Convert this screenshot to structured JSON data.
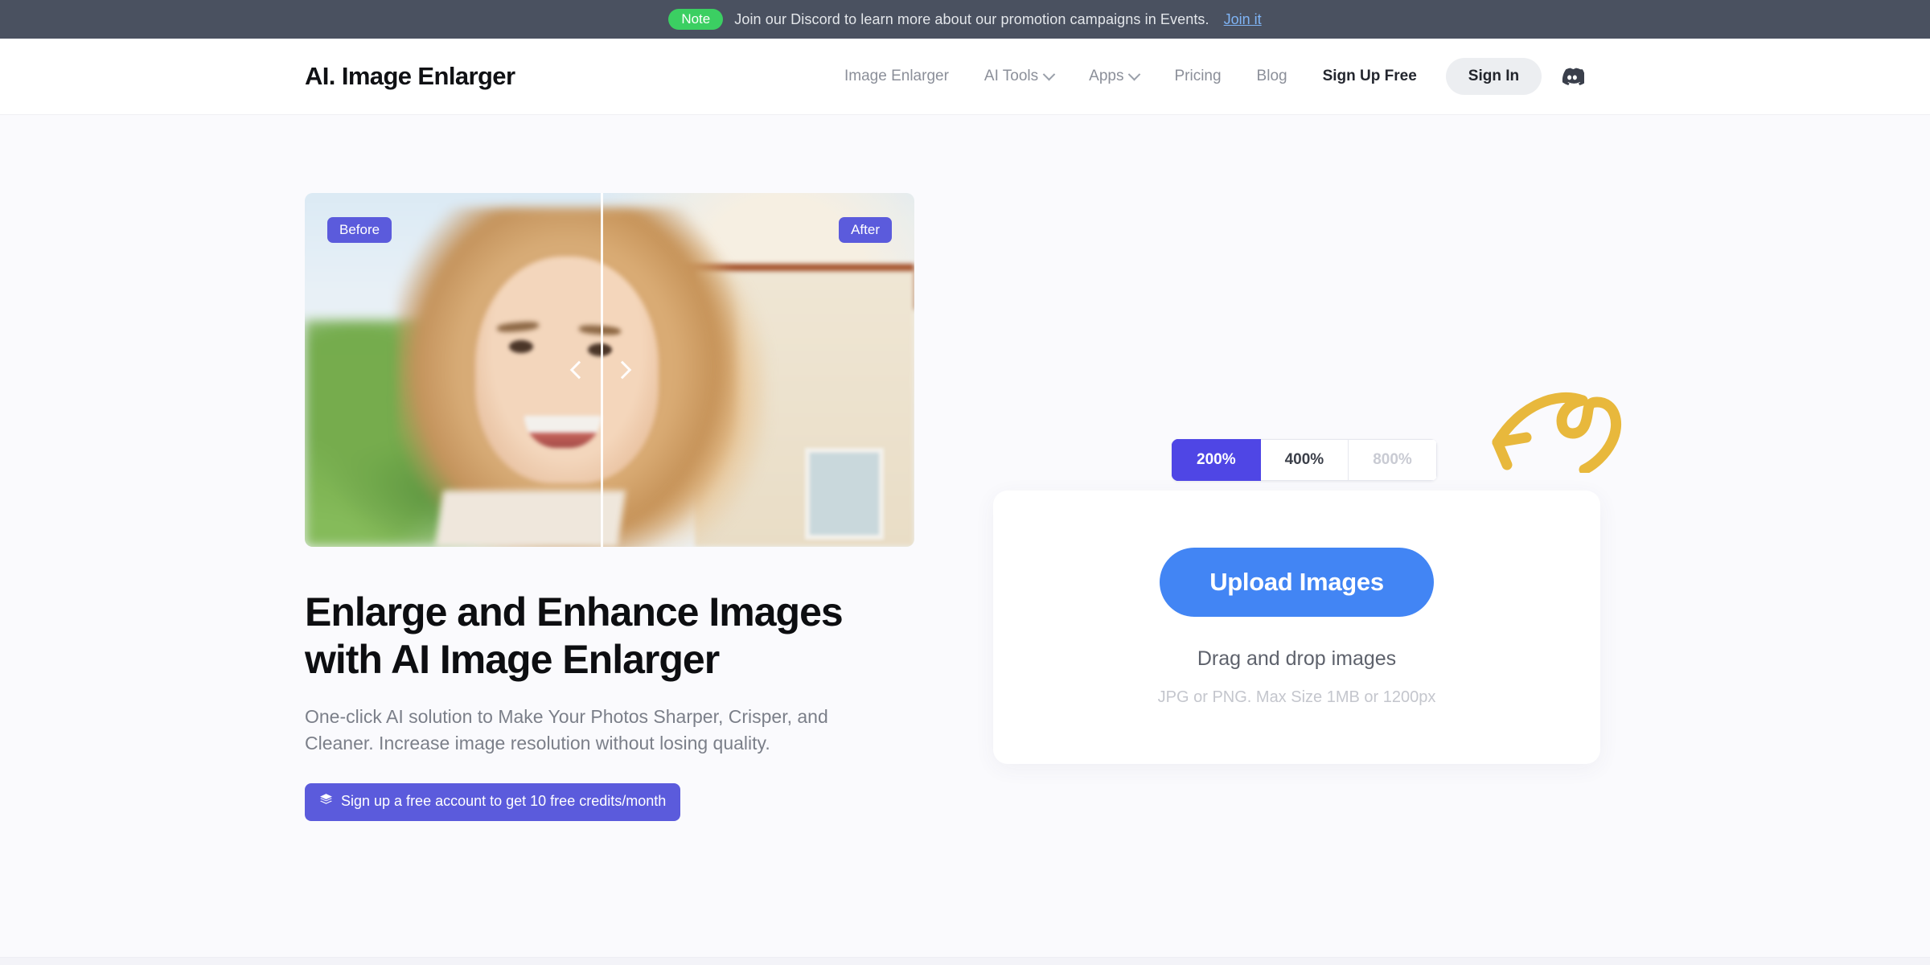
{
  "notice": {
    "badge": "Note",
    "text": "Join our Discord to learn more about our promotion campaigns in Events.",
    "link_label": "Join it",
    "badge_color": "#3bcf62",
    "bar_color": "#4a5160"
  },
  "header": {
    "logo": "AI. Image Enlarger",
    "nav": [
      {
        "label": "Image Enlarger",
        "has_chevron": false
      },
      {
        "label": "AI Tools",
        "has_chevron": true
      },
      {
        "label": "Apps",
        "has_chevron": true
      },
      {
        "label": "Pricing",
        "has_chevron": false
      },
      {
        "label": "Blog",
        "has_chevron": false
      },
      {
        "label": "Sign Up Free",
        "has_chevron": false
      }
    ],
    "sign_in_label": "Sign In",
    "discord_icon": "discord-icon"
  },
  "hero": {
    "compare": {
      "before_badge": "Before",
      "after_badge": "After",
      "prev_icon": "chevron-left-icon",
      "next_icon": "chevron-right-icon",
      "badge_color": "#5b5bdc"
    },
    "headline": "Enlarge and Enhance Images with AI Image Enlarger",
    "subhead": "One-click AI solution to Make Your Photos Sharper, Crisper, and Cleaner. Increase image resolution without losing quality.",
    "credits_cta": {
      "icon": "layers-icon",
      "label": "Sign up a free account to get 10 free credits/month",
      "color": "#5b5bdc"
    }
  },
  "uploader": {
    "scales": [
      {
        "label": "200%",
        "state": "active"
      },
      {
        "label": "400%",
        "state": "default"
      },
      {
        "label": "800%",
        "state": "disabled"
      }
    ],
    "upload_button": "Upload Images",
    "drag_text": "Drag and drop images",
    "hint_text": "JPG or PNG. Max Size 1MB or 1200px",
    "upload_color": "#4285f4",
    "active_scale_color": "#4f46e5",
    "doodle_arrow_color": "#e8b83c"
  }
}
